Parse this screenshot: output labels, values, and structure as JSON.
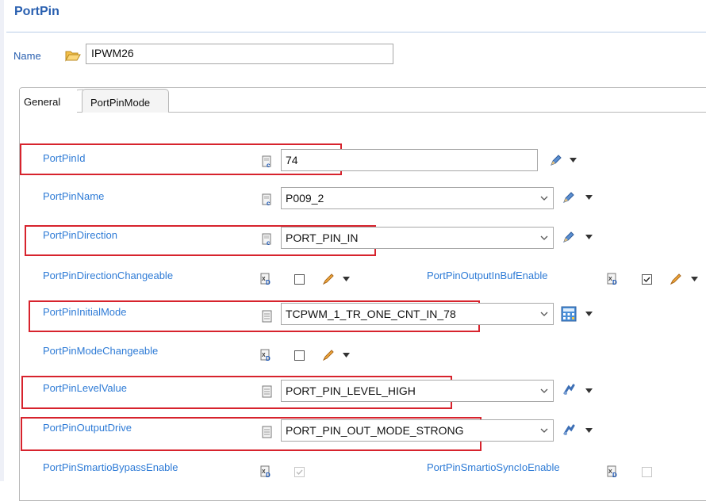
{
  "header": {
    "title": "PortPin"
  },
  "name_row": {
    "label": "Name",
    "value": "IPWM26"
  },
  "tabs": [
    {
      "label": "General"
    },
    {
      "label": "PortPinMode"
    }
  ],
  "fields": {
    "port_pin_id": {
      "label": "PortPinId",
      "value": "74"
    },
    "port_pin_name": {
      "label": "PortPinName",
      "value": "P009_2"
    },
    "port_pin_direction": {
      "label": "PortPinDirection",
      "value": "PORT_PIN_IN"
    },
    "port_pin_direction_changeable": {
      "label": "PortPinDirectionChangeable",
      "checked": false
    },
    "port_pin_output_in_buf_enable": {
      "label": "PortPinOutputInBufEnable",
      "checked": true
    },
    "port_pin_initial_mode": {
      "label": "PortPinInitialMode",
      "value": "TCPWM_1_TR_ONE_CNT_IN_78"
    },
    "port_pin_mode_changeable": {
      "label": "PortPinModeChangeable",
      "checked": false
    },
    "port_pin_level_value": {
      "label": "PortPinLevelValue",
      "value": "PORT_PIN_LEVEL_HIGH"
    },
    "port_pin_output_drive": {
      "label": "PortPinOutputDrive",
      "value": "PORT_PIN_OUT_MODE_STRONG"
    },
    "port_pin_smartio_bypass_enable": {
      "label": "PortPinSmartioBypassEnable",
      "checked": true,
      "disabled": true
    },
    "port_pin_smartio_sync_io_enable": {
      "label": "PortPinSmartioSyncIoEnable",
      "checked": false,
      "disabled": true
    }
  },
  "icons": {
    "folder": "folder-open-icon",
    "definition": "document-definition-icon",
    "xsd": "xsd-type-icon",
    "edit": "pencil-icon",
    "calculator": "calculator-icon",
    "link": "link-icon",
    "dropdown": "chevron-down-icon"
  },
  "colors": {
    "label": "#2e7bd6",
    "title": "#2a60b0",
    "highlight": "#d7232d"
  }
}
